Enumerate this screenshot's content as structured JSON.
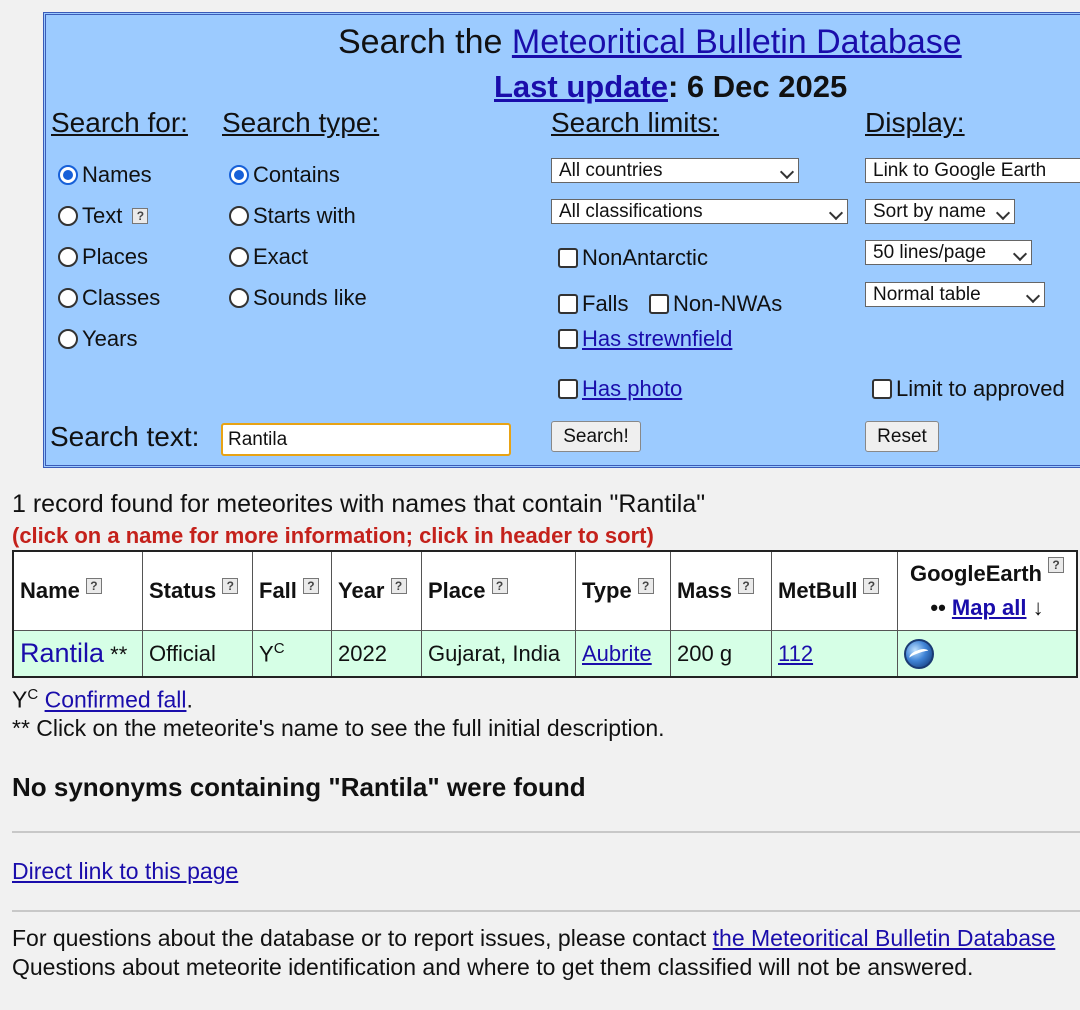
{
  "header": {
    "title_prefix": "Search the ",
    "title_link": "Meteoritical Bulletin Database",
    "update_link": "Last update",
    "update_date": ": 6 Dec 2025"
  },
  "columns": {
    "search_for": "Search for:",
    "search_type": "Search type:",
    "search_limits": "Search limits:",
    "display": "Display:"
  },
  "search_for": [
    "Names",
    "Text",
    "Places",
    "Classes",
    "Years"
  ],
  "search_for_selected": "Names",
  "search_type": [
    "Contains",
    "Starts with",
    "Exact",
    "Sounds like"
  ],
  "search_type_selected": "Contains",
  "limits": {
    "countries": "All countries",
    "classifications": "All classifications",
    "non_antarctic": "NonAntarctic",
    "falls": "Falls",
    "non_nwas": "Non-NWAs",
    "has_strewnfield": "Has strewnfield",
    "has_photo": "Has photo"
  },
  "display": {
    "earth": "Link to Google Earth",
    "sort": "Sort by name",
    "lines": "50 lines/page",
    "table": "Normal table",
    "limit_approved": "Limit to approved"
  },
  "search": {
    "label": "Search text:",
    "value": "Rantila",
    "submit": "Search!",
    "reset": "Reset"
  },
  "results": {
    "summary": "1 record found for meteorites with names that contain \"Rantila\"",
    "hint": "(click on a name for more information; click in header to sort)",
    "headers": {
      "name": "Name",
      "status": "Status",
      "fall": "Fall",
      "year": "Year",
      "place": "Place",
      "type": "Type",
      "mass": "Mass",
      "metbull": "MetBull",
      "googleearth": "GoogleEarth",
      "map_all": "Map all",
      "map_bullets": "••",
      "map_arrow": "↓"
    },
    "row": {
      "name": "Rantila",
      "name_mark": " **",
      "status": "Official",
      "fall": "Y",
      "fall_sup": "C",
      "year": "2022",
      "place": "Gujarat, India",
      "type": "Aubrite",
      "mass": "200 g",
      "metbull": "112"
    }
  },
  "footnotes": {
    "fall_code": "Y",
    "fall_sup": "C",
    "confirmed_fall": "Confirmed fall",
    "period": ".",
    "name_note": "** Click on the meteorite's name to see the full initial description."
  },
  "synonyms": "No synonyms containing \"Rantila\" were found",
  "direct_link": "Direct link to this page",
  "contact": {
    "prefix": "For questions about the database or to report issues, please contact ",
    "link": "the Meteoritical Bulletin Database",
    "line2": "Questions about meteorite identification and where to get them classified will not be answered."
  }
}
